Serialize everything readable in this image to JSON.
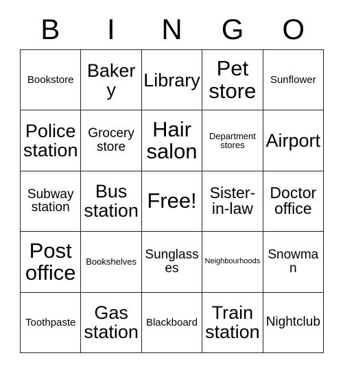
{
  "header": {
    "letters": [
      "B",
      "I",
      "N",
      "G",
      "O"
    ]
  },
  "grid": {
    "rows": 5,
    "columns": 5,
    "border_color": "#222222",
    "background_color": "#ffffff",
    "text_color": "#000000",
    "cells": [
      {
        "text": "Bookstore",
        "size": "fs-s"
      },
      {
        "text": "Bakery",
        "size": "fs-xl"
      },
      {
        "text": "Library",
        "size": "fs-xl"
      },
      {
        "text": "Pet store",
        "size": "fs-xxl"
      },
      {
        "text": "Sunflower",
        "size": "fs-s"
      },
      {
        "text": "Police station",
        "size": "fs-xl"
      },
      {
        "text": "Grocery store",
        "size": "fs-m"
      },
      {
        "text": "Hair salon",
        "size": "fs-xxl"
      },
      {
        "text": "Department stores",
        "size": "fs-xs"
      },
      {
        "text": "Airport",
        "size": "fs-xl"
      },
      {
        "text": "Subway station",
        "size": "fs-m"
      },
      {
        "text": "Bus station",
        "size": "fs-xl"
      },
      {
        "text": "Free!",
        "size": "fs-xxl"
      },
      {
        "text": "Sister-in-law",
        "size": "fs-l"
      },
      {
        "text": "Doctor office",
        "size": "fs-l"
      },
      {
        "text": "Post office",
        "size": "fs-xxl"
      },
      {
        "text": "Bookshelves",
        "size": "fs-xs"
      },
      {
        "text": "Sunglasses",
        "size": "fs-m"
      },
      {
        "text": "Neighbourhoods",
        "size": "fs-xxs"
      },
      {
        "text": "Snowman",
        "size": "fs-m"
      },
      {
        "text": "Toothpaste",
        "size": "fs-s"
      },
      {
        "text": "Gas station",
        "size": "fs-xl"
      },
      {
        "text": "Blackboard",
        "size": "fs-s"
      },
      {
        "text": "Train station",
        "size": "fs-xl"
      },
      {
        "text": "Nightclub",
        "size": "fs-m"
      }
    ]
  }
}
